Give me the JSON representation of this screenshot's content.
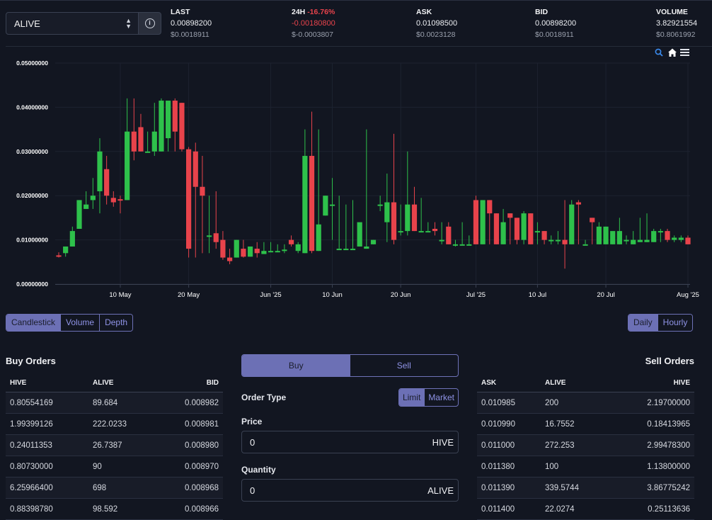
{
  "market": {
    "token": "ALIVE",
    "stats": [
      {
        "label": "LAST",
        "label_change": "",
        "v1": "0.00898200",
        "v2": "$0.0018911",
        "neg": false
      },
      {
        "label": "24H",
        "label_change": "-16.76%",
        "v1": "-0.00180800",
        "v2": "$-0.0003807",
        "neg": true
      },
      {
        "label": "ASK",
        "label_change": "",
        "v1": "0.01098500",
        "v2": "$0.0023128",
        "neg": false
      },
      {
        "label": "BID",
        "label_change": "",
        "v1": "0.00898200",
        "v2": "$0.0018911",
        "neg": false
      },
      {
        "label": "VOLUME",
        "label_change": "",
        "v1": "3.82921554",
        "v2": "$0.8061992",
        "neg": false
      }
    ]
  },
  "chart_data": {
    "type": "candlestick",
    "ylim": [
      0,
      0.05
    ],
    "y_ticks": [
      "0.05000000",
      "0.04000000",
      "0.03000000",
      "0.02000000",
      "0.01000000",
      "0.00000000"
    ],
    "x_ticks": [
      "10 May",
      "20 May",
      "Jun '25",
      "10 Jun",
      "20 Jun",
      "Jul '25",
      "10 Jul",
      "20 Jul",
      "Aug '25"
    ],
    "x_tick_days": [
      9,
      19,
      31,
      40,
      50,
      61,
      70,
      80,
      92
    ],
    "colors": {
      "up": "#2ec14b",
      "down": "#e8434b",
      "grid": "#1d2230"
    },
    "candles": [
      [
        0,
        0.0065,
        0.0072,
        0.006,
        0.0062
      ],
      [
        1,
        0.007,
        0.0085,
        0.0062,
        0.0085
      ],
      [
        2,
        0.0085,
        0.013,
        0.0085,
        0.012
      ],
      [
        3,
        0.0125,
        0.019,
        0.0125,
        0.019
      ],
      [
        4,
        0.017,
        0.021,
        0.017,
        0.018
      ],
      [
        5,
        0.019,
        0.024,
        0.017,
        0.02
      ],
      [
        6,
        0.021,
        0.033,
        0.016,
        0.03
      ],
      [
        7,
        0.026,
        0.029,
        0.018,
        0.02
      ],
      [
        8,
        0.0195,
        0.021,
        0.0175,
        0.0185
      ],
      [
        9,
        0.0192,
        0.02,
        0.016,
        0.019
      ],
      [
        10,
        0.019,
        0.042,
        0.019,
        0.0345
      ],
      [
        11,
        0.0345,
        0.042,
        0.028,
        0.03
      ],
      [
        12,
        0.0355,
        0.0385,
        0.03,
        0.03
      ],
      [
        13,
        0.03,
        0.0345,
        0.03,
        0.03
      ],
      [
        14,
        0.03,
        0.041,
        0.029,
        0.0345
      ],
      [
        15,
        0.03,
        0.042,
        0.03,
        0.0415
      ],
      [
        16,
        0.033,
        0.0415,
        0.03,
        0.0415
      ],
      [
        17,
        0.0415,
        0.042,
        0.03,
        0.0345
      ],
      [
        18,
        0.041,
        0.041,
        0.03,
        0.0305
      ],
      [
        19,
        0.0305,
        0.031,
        0.006,
        0.008
      ],
      [
        20,
        0.03,
        0.032,
        0.006,
        0.022
      ],
      [
        21,
        0.022,
        0.029,
        0.007,
        0.02
      ],
      [
        22,
        0.011,
        0.02,
        0.007,
        0.011
      ],
      [
        23,
        0.0115,
        0.021,
        0.008,
        0.0095
      ],
      [
        24,
        0.01,
        0.012,
        0.0055,
        0.006
      ],
      [
        25,
        0.006,
        0.008,
        0.0045,
        0.0052
      ],
      [
        26,
        0.006,
        0.01,
        0.006,
        0.01
      ],
      [
        27,
        0.008,
        0.01,
        0.006,
        0.0062
      ],
      [
        28,
        0.0062,
        0.0085,
        0.0062,
        0.0085
      ],
      [
        29,
        0.008,
        0.0095,
        0.006,
        0.007
      ],
      [
        30,
        0.0068,
        0.0095,
        0.0068,
        0.0075
      ],
      [
        31,
        0.0072,
        0.0095,
        0.0072,
        0.0075
      ],
      [
        32,
        0.0072,
        0.009,
        0.0072,
        0.0075
      ],
      [
        33,
        0.0078,
        0.009,
        0.007,
        0.0078
      ],
      [
        34,
        0.01,
        0.011,
        0.0085,
        0.009
      ],
      [
        35,
        0.0075,
        0.0095,
        0.007,
        0.009
      ],
      [
        36,
        0.007,
        0.035,
        0.007,
        0.029
      ],
      [
        37,
        0.029,
        0.039,
        0.007,
        0.0075
      ],
      [
        38,
        0.0075,
        0.035,
        0.0075,
        0.0135
      ],
      [
        39,
        0.0155,
        0.02,
        0.0155,
        0.02
      ],
      [
        40,
        0.018,
        0.024,
        0.01,
        0.018
      ],
      [
        41,
        0.008,
        0.02,
        0.008,
        0.008
      ],
      [
        42,
        0.008,
        0.018,
        0.008,
        0.008
      ],
      [
        43,
        0.008,
        0.019,
        0.008,
        0.008
      ],
      [
        44,
        0.0085,
        0.01,
        0.0085,
        0.014
      ],
      [
        45,
        0.008,
        0.035,
        0.008,
        0.0085
      ],
      [
        46,
        0.009,
        0.01,
        0.009,
        0.01
      ],
      [
        47,
        0.018,
        0.02,
        0.0165,
        0.018
      ],
      [
        48,
        0.014,
        0.025,
        0.0095,
        0.0185
      ],
      [
        49,
        0.0185,
        0.034,
        0.009,
        0.01
      ],
      [
        50,
        0.012,
        0.018,
        0.011,
        0.012
      ],
      [
        51,
        0.012,
        0.03,
        0.011,
        0.018
      ],
      [
        52,
        0.018,
        0.022,
        0.012,
        0.012
      ],
      [
        53,
        0.012,
        0.0195,
        0.012,
        0.012
      ],
      [
        54,
        0.012,
        0.014,
        0.012,
        0.012
      ],
      [
        55,
        0.0125,
        0.014,
        0.011,
        0.012
      ],
      [
        56,
        0.01,
        0.014,
        0.009,
        0.01
      ],
      [
        57,
        0.013,
        0.014,
        0.009,
        0.009
      ],
      [
        58,
        0.009,
        0.01,
        0.0085,
        0.009
      ],
      [
        59,
        0.009,
        0.014,
        0.009,
        0.009
      ],
      [
        60,
        0.009,
        0.011,
        0.009,
        0.009
      ],
      [
        61,
        0.019,
        0.02,
        0.009,
        0.009
      ],
      [
        62,
        0.009,
        0.019,
        0.009,
        0.019
      ],
      [
        63,
        0.019,
        0.019,
        0.009,
        0.016
      ],
      [
        64,
        0.016,
        0.016,
        0.009,
        0.009
      ],
      [
        65,
        0.009,
        0.017,
        0.009,
        0.014
      ],
      [
        66,
        0.016,
        0.016,
        0.009,
        0.015
      ],
      [
        67,
        0.015,
        0.015,
        0.009,
        0.01
      ],
      [
        68,
        0.01,
        0.0165,
        0.009,
        0.016
      ],
      [
        69,
        0.016,
        0.016,
        0.009,
        0.009
      ],
      [
        70,
        0.012,
        0.014,
        0.009,
        0.012
      ],
      [
        71,
        0.012,
        0.012,
        0.009,
        0.01
      ],
      [
        72,
        0.01,
        0.011,
        0.009,
        0.01
      ],
      [
        73,
        0.01,
        0.012,
        0.009,
        0.01
      ],
      [
        74,
        0.01,
        0.019,
        0.0035,
        0.009
      ],
      [
        75,
        0.009,
        0.019,
        0.009,
        0.018
      ],
      [
        76,
        0.0185,
        0.019,
        0.009,
        0.018
      ],
      [
        77,
        0.009,
        0.01,
        0.009,
        0.009
      ],
      [
        78,
        0.015,
        0.015,
        0.009,
        0.014
      ],
      [
        79,
        0.009,
        0.014,
        0.009,
        0.013
      ],
      [
        80,
        0.009,
        0.013,
        0.009,
        0.013
      ],
      [
        81,
        0.009,
        0.011,
        0.009,
        0.012
      ],
      [
        82,
        0.009,
        0.015,
        0.009,
        0.012
      ],
      [
        83,
        0.01,
        0.011,
        0.009,
        0.01
      ],
      [
        84,
        0.009,
        0.012,
        0.009,
        0.01
      ],
      [
        85,
        0.0095,
        0.015,
        0.0095,
        0.01
      ],
      [
        86,
        0.0095,
        0.016,
        0.0095,
        0.01
      ],
      [
        87,
        0.0095,
        0.0125,
        0.0095,
        0.012
      ],
      [
        88,
        0.012,
        0.0125,
        0.0095,
        0.012
      ],
      [
        89,
        0.012,
        0.0125,
        0.0095,
        0.01
      ],
      [
        90,
        0.01,
        0.011,
        0.0095,
        0.0105
      ],
      [
        91,
        0.01,
        0.011,
        0.0095,
        0.0105
      ],
      [
        92,
        0.0105,
        0.011,
        0.009,
        0.009
      ]
    ]
  },
  "chart_toolbar": [
    "zoom-icon",
    "home-icon",
    "menu-icon"
  ],
  "chart_type_buttons": [
    "Candlestick",
    "Volume",
    "Depth"
  ],
  "interval_buttons": [
    "Daily",
    "Hourly"
  ],
  "buy_orders": {
    "title": "Buy Orders",
    "columns": [
      "HIVE",
      "ALIVE",
      "BID"
    ],
    "rows": [
      [
        "0.80554169",
        "89.684",
        "0.008982"
      ],
      [
        "1.99399126",
        "222.0233",
        "0.008981"
      ],
      [
        "0.24011353",
        "26.7387",
        "0.008980"
      ],
      [
        "0.80730000",
        "90",
        "0.008970"
      ],
      [
        "6.25966400",
        "698",
        "0.008968"
      ],
      [
        "0.88398780",
        "98.592",
        "0.008966"
      ]
    ]
  },
  "sell_orders": {
    "title": "Sell Orders",
    "columns": [
      "ASK",
      "ALIVE",
      "HIVE"
    ],
    "rows": [
      [
        "0.010985",
        "200",
        "2.19700000"
      ],
      [
        "0.010990",
        "16.7552",
        "0.18413965"
      ],
      [
        "0.011000",
        "272.253",
        "2.99478300"
      ],
      [
        "0.011380",
        "100",
        "1.13800000"
      ],
      [
        "0.011390",
        "339.5744",
        "3.86775242"
      ],
      [
        "0.011400",
        "22.0274",
        "0.25113636"
      ]
    ]
  },
  "order_form": {
    "buy_tab": "Buy",
    "sell_tab": "Sell",
    "order_type_label": "Order Type",
    "order_types": [
      "Limit",
      "Market"
    ],
    "price_label": "Price",
    "price_value": "0",
    "price_unit": "HIVE",
    "quantity_label": "Quantity",
    "quantity_value": "0",
    "quantity_unit": "ALIVE"
  }
}
